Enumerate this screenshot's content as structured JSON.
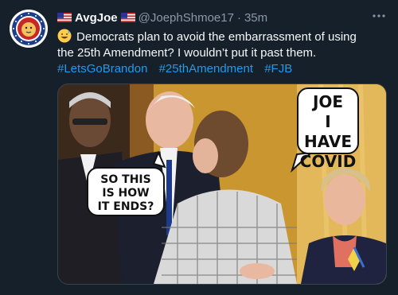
{
  "tweet": {
    "display_name": "AvgJoe",
    "handle": "@JoephShmoe17",
    "separator": "·",
    "time": "35m",
    "more_label": "···",
    "text_line1": "Democrats plan to avoid the embarrassment of using",
    "text_line2": "the 25th Amendment?  I wouldn’t put it past them.",
    "hashtags": [
      "#LetsGoBrandon",
      "#25thAmendment",
      "#FJB"
    ],
    "emoji": "grinning-sweat-face-icon"
  },
  "image": {
    "bubble_left": [
      "SO THIS",
      "IS HOW",
      "IT ENDS?"
    ],
    "bubble_right": [
      "JOE",
      "I HAVE",
      "COVID"
    ]
  },
  "colors": {
    "background": "#15202b",
    "link": "#1d9bf0",
    "secondary_text": "#8b98a5"
  }
}
